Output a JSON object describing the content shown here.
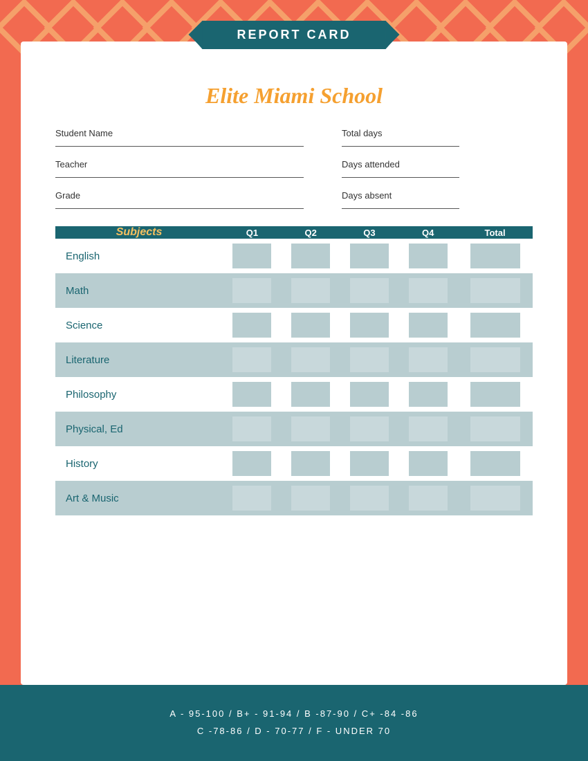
{
  "page": {
    "background_color": "#f26a50"
  },
  "banner": {
    "label": "REPORT CARD"
  },
  "school": {
    "name": "Elite Miami School"
  },
  "form": {
    "student_name_label": "Student Name",
    "teacher_label": "Teacher",
    "grade_label": "Grade",
    "total_days_label": "Total days",
    "days_attended_label": "Days attended",
    "days_absent_label": "Days absent"
  },
  "table": {
    "subjects_header": "Subjects",
    "q1_header": "Q1",
    "q2_header": "Q2",
    "q3_header": "Q3",
    "q4_header": "Q4",
    "total_header": "Total",
    "rows": [
      {
        "subject": "English",
        "style": "white"
      },
      {
        "subject": "Math",
        "style": "blue"
      },
      {
        "subject": "Science",
        "style": "white"
      },
      {
        "subject": "Literature",
        "style": "blue"
      },
      {
        "subject": "Philosophy",
        "style": "white"
      },
      {
        "subject": "Physical, Ed",
        "style": "blue"
      },
      {
        "subject": "History",
        "style": "white"
      },
      {
        "subject": "Art & Music",
        "style": "blue"
      }
    ]
  },
  "grading_scale": {
    "line1": "A - 95-100 / B+ - 91-94 / B -87-90 / C+ -84 -86",
    "line2": "C -78-86 / D - 70-77 / F - UNDER 70"
  }
}
